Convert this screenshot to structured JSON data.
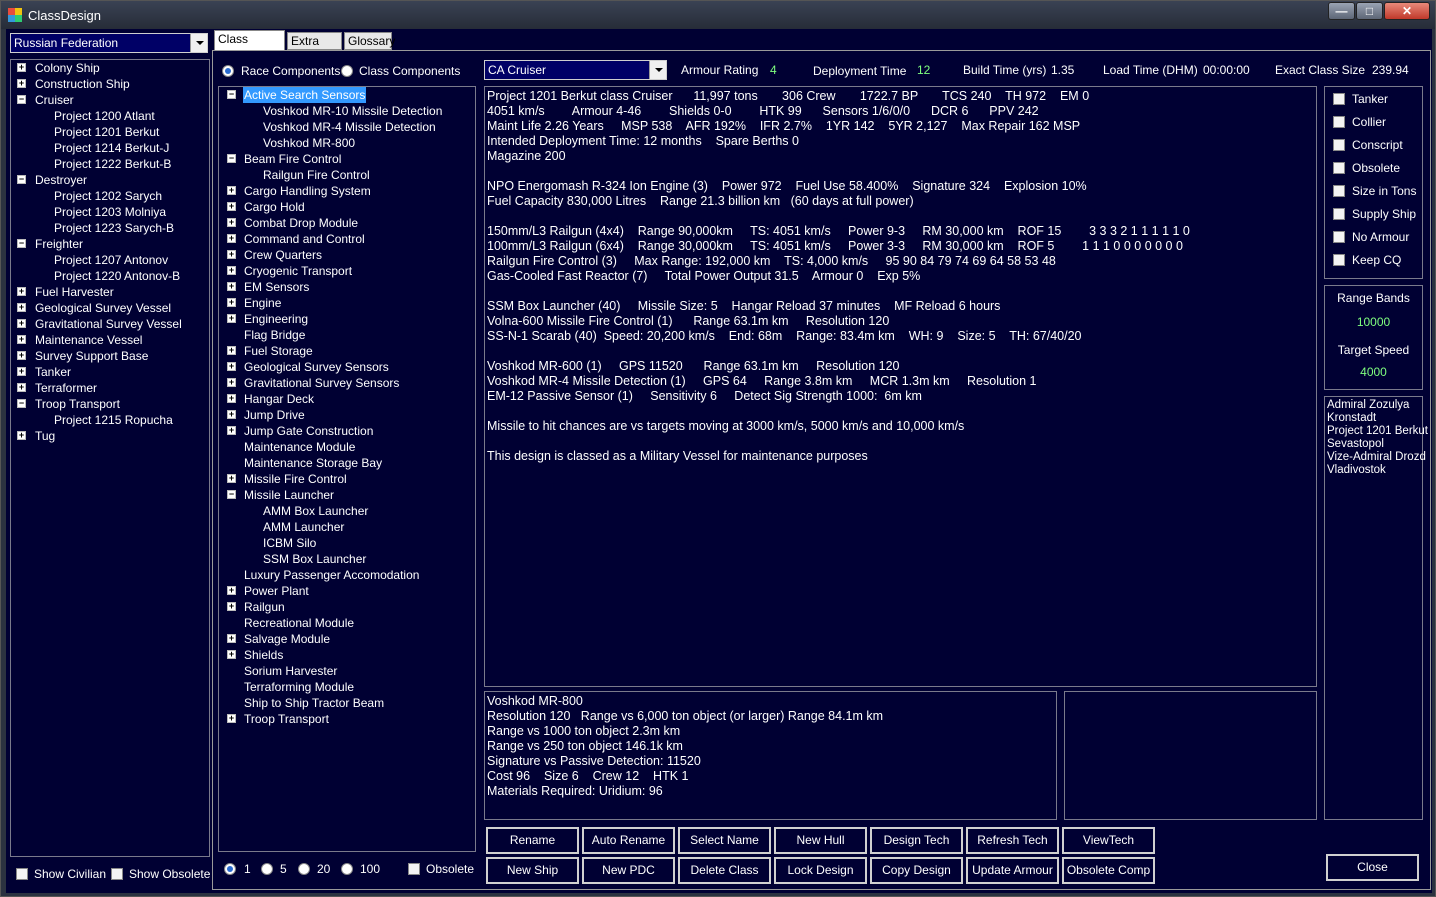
{
  "window": {
    "title": "ClassDesign",
    "minimize": "—",
    "maximize": "□",
    "close": "✕"
  },
  "race_select": "Russian Federation",
  "class_tree": [
    {
      "label": "Colony Ship",
      "level": 0,
      "expander": "+"
    },
    {
      "label": "Construction Ship",
      "level": 0,
      "expander": "+"
    },
    {
      "label": "Cruiser",
      "level": 0,
      "expander": "−"
    },
    {
      "label": "Project 1200 Atlant",
      "level": 1,
      "expander": ""
    },
    {
      "label": "Project 1201 Berkut",
      "level": 1,
      "expander": ""
    },
    {
      "label": "Project 1214 Berkut-J",
      "level": 1,
      "expander": ""
    },
    {
      "label": "Project 1222 Berkut-B",
      "level": 1,
      "expander": ""
    },
    {
      "label": "Destroyer",
      "level": 0,
      "expander": "−"
    },
    {
      "label": "Project 1202 Sarych",
      "level": 1,
      "expander": ""
    },
    {
      "label": "Project 1203 Molniya",
      "level": 1,
      "expander": ""
    },
    {
      "label": "Project 1223 Sarych-B",
      "level": 1,
      "expander": ""
    },
    {
      "label": "Freighter",
      "level": 0,
      "expander": "−"
    },
    {
      "label": "Project 1207 Antonov",
      "level": 1,
      "expander": ""
    },
    {
      "label": "Project 1220 Antonov-B",
      "level": 1,
      "expander": ""
    },
    {
      "label": "Fuel Harvester",
      "level": 0,
      "expander": "+"
    },
    {
      "label": "Geological Survey Vessel",
      "level": 0,
      "expander": "+"
    },
    {
      "label": "Gravitational Survey Vessel",
      "level": 0,
      "expander": "+"
    },
    {
      "label": "Maintenance Vessel",
      "level": 0,
      "expander": "+"
    },
    {
      "label": "Survey Support Base",
      "level": 0,
      "expander": "+"
    },
    {
      "label": "Tanker",
      "level": 0,
      "expander": "+"
    },
    {
      "label": "Terraformer",
      "level": 0,
      "expander": "+"
    },
    {
      "label": "Troop Transport",
      "level": 0,
      "expander": "−"
    },
    {
      "label": "Project 1215 Ropucha",
      "level": 1,
      "expander": ""
    },
    {
      "label": "Tug",
      "level": 0,
      "expander": "+"
    }
  ],
  "bottom_left": {
    "show_civilian": "Show Civilian",
    "show_obsolete": "Show Obsolete"
  },
  "tabs": [
    "Class Design",
    "Extra Info",
    "Glossary"
  ],
  "component_source": {
    "race": "Race Components",
    "class": "Class Components"
  },
  "component_tree": [
    {
      "label": "Active Search Sensors",
      "level": 0,
      "expander": "−",
      "selected": true
    },
    {
      "label": "Voshkod MR-10 Missile Detection",
      "level": 1,
      "expander": ""
    },
    {
      "label": "Voshkod MR-4 Missile Detection",
      "level": 1,
      "expander": ""
    },
    {
      "label": "Voshkod MR-800",
      "level": 1,
      "expander": ""
    },
    {
      "label": "Beam Fire Control",
      "level": 0,
      "expander": "−"
    },
    {
      "label": "Railgun Fire Control",
      "level": 1,
      "expander": ""
    },
    {
      "label": "Cargo Handling System",
      "level": 0,
      "expander": "+"
    },
    {
      "label": "Cargo Hold",
      "level": 0,
      "expander": "+"
    },
    {
      "label": "Combat Drop Module",
      "level": 0,
      "expander": "+"
    },
    {
      "label": "Command and Control",
      "level": 0,
      "expander": "+"
    },
    {
      "label": "Crew Quarters",
      "level": 0,
      "expander": "+"
    },
    {
      "label": "Cryogenic Transport",
      "level": 0,
      "expander": "+"
    },
    {
      "label": "EM Sensors",
      "level": 0,
      "expander": "+"
    },
    {
      "label": "Engine",
      "level": 0,
      "expander": "+"
    },
    {
      "label": "Engineering",
      "level": 0,
      "expander": "+"
    },
    {
      "label": "Flag Bridge",
      "level": 0,
      "expander": ""
    },
    {
      "label": "Fuel Storage",
      "level": 0,
      "expander": "+"
    },
    {
      "label": "Geological Survey Sensors",
      "level": 0,
      "expander": "+"
    },
    {
      "label": "Gravitational Survey Sensors",
      "level": 0,
      "expander": "+"
    },
    {
      "label": "Hangar Deck",
      "level": 0,
      "expander": "+"
    },
    {
      "label": "Jump Drive",
      "level": 0,
      "expander": "+"
    },
    {
      "label": "Jump Gate Construction",
      "level": 0,
      "expander": "+"
    },
    {
      "label": "Maintenance Module",
      "level": 0,
      "expander": ""
    },
    {
      "label": "Maintenance Storage Bay",
      "level": 0,
      "expander": ""
    },
    {
      "label": "Missile Fire Control",
      "level": 0,
      "expander": "+"
    },
    {
      "label": "Missile Launcher",
      "level": 0,
      "expander": "−"
    },
    {
      "label": "AMM Box Launcher",
      "level": 1,
      "expander": ""
    },
    {
      "label": "AMM Launcher",
      "level": 1,
      "expander": ""
    },
    {
      "label": "ICBM Silo",
      "level": 1,
      "expander": ""
    },
    {
      "label": "SSM Box Launcher",
      "level": 1,
      "expander": ""
    },
    {
      "label": "Luxury Passenger Accomodation",
      "level": 0,
      "expander": ""
    },
    {
      "label": "Power Plant",
      "level": 0,
      "expander": "+"
    },
    {
      "label": "Railgun",
      "level": 0,
      "expander": "+"
    },
    {
      "label": "Recreational Module",
      "level": 0,
      "expander": ""
    },
    {
      "label": "Salvage Module",
      "level": 0,
      "expander": "+"
    },
    {
      "label": "Shields",
      "level": 0,
      "expander": "+"
    },
    {
      "label": "Sorium Harvester",
      "level": 0,
      "expander": ""
    },
    {
      "label": "Terraforming Module",
      "level": 0,
      "expander": ""
    },
    {
      "label": "Ship to Ship Tractor Beam",
      "level": 0,
      "expander": ""
    },
    {
      "label": "Troop Transport",
      "level": 0,
      "expander": "+"
    }
  ],
  "quantity_options": [
    "1",
    "5",
    "20",
    "100"
  ],
  "obsolete_label": "Obsolete",
  "header": {
    "class_select": "CA Cruiser",
    "armour_rating_label": "Armour Rating",
    "armour_rating": "4",
    "deployment_time_label": "Deployment Time",
    "deployment_time": "12",
    "build_time_label": "Build Time (yrs)",
    "build_time": "1.35",
    "load_time_label": "Load Time (DHM)",
    "load_time": "00:00:00",
    "exact_size_label": "Exact Class Size",
    "exact_size": "239.94"
  },
  "class_summary": [
    "Project 1201 Berkut class Cruiser      11,997 tons       306 Crew       1722.7 BP       TCS 240    TH 972    EM 0",
    "4051 km/s        Armour 4-46        Shields 0-0        HTK 99      Sensors 1/6/0/0      DCR 6      PPV 242",
    "Maint Life 2.26 Years     MSP 538    AFR 192%    IFR 2.7%    1YR 142    5YR 2,127    Max Repair 162 MSP",
    "Intended Deployment Time: 12 months    Spare Berths 0",
    "Magazine 200",
    "",
    "NPO Energomash R-324 Ion Engine (3)    Power 972    Fuel Use 58.400%    Signature 324    Explosion 10%",
    "Fuel Capacity 830,000 Litres    Range 21.3 billion km   (60 days at full power)",
    "",
    "150mm/L3 Railgun (4x4)    Range 90,000km     TS: 4051 km/s     Power 9-3     RM 30,000 km    ROF 15        3 3 3 2 1 1 1 1 1 0",
    "100mm/L3 Railgun (6x4)    Range 30,000km     TS: 4051 km/s     Power 3-3     RM 30,000 km    ROF 5        1 1 1 0 0 0 0 0 0 0",
    "Railgun Fire Control (3)     Max Range: 192,000 km    TS: 4,000 km/s     95 90 84 79 74 69 64 58 53 48",
    "Gas-Cooled Fast Reactor (7)     Total Power Output 31.5    Armour 0    Exp 5%",
    "",
    "SSM Box Launcher (40)     Missile Size: 5    Hangar Reload 37 minutes    MF Reload 6 hours",
    "Volna-600 Missile Fire Control (1)      Range 63.1m km     Resolution 120",
    "SS-N-1 Scarab (40)  Speed: 20,200 km/s    End: 68m    Range: 83.4m km    WH: 9    Size: 5    TH: 67/40/20",
    "",
    "Voshkod MR-600 (1)     GPS 11520      Range 63.1m km     Resolution 120",
    "Voshkod MR-4 Missile Detection (1)     GPS 64     Range 3.8m km     MCR 1.3m km     Resolution 1",
    "EM-12 Passive Sensor (1)     Sensitivity 6     Detect Sig Strength 1000:  6m km",
    "",
    "Missile to hit chances are vs targets moving at 3000 km/s, 5000 km/s and 10,000 km/s",
    "",
    "This design is classed as a Military Vessel for maintenance purposes"
  ],
  "component_detail": [
    "Voshkod MR-800",
    "Resolution 120   Range vs 6,000 ton object (or larger) Range 84.1m km",
    "Range vs 1000 ton object 2.3m km",
    "Range vs 250 ton object 146.1k km",
    "Signature vs Passive Detection: 11520",
    "Cost 96    Size 6    Crew 12    HTK 1",
    "Materials Required: Uridium: 96"
  ],
  "flags": [
    "Tanker",
    "Collier",
    "Conscript",
    "Obsolete",
    "Size in Tons",
    "Supply Ship",
    "No Armour",
    "Keep CQ"
  ],
  "range_bands": {
    "label": "Range Bands",
    "value": "10000",
    "target_speed_label": "Target Speed",
    "target_speed": "4000"
  },
  "fleet_info": [
    "Admiral Zozulya",
    "Kronstadt",
    "Project 1201 Berkut",
    "Sevastopol",
    "Vize-Admiral Drozd",
    "Vladivostok"
  ],
  "buttons_row1": [
    "Rename",
    "Auto Rename",
    "Select Name",
    "New Hull",
    "Design Tech",
    "Refresh Tech",
    "ViewTech"
  ],
  "buttons_row2": [
    "New Ship",
    "New PDC",
    "Delete Class",
    "Lock Design",
    "Copy Design",
    "Update Armour",
    "Obsolete Comp"
  ],
  "close_button": "Close",
  "colors": {
    "background": "#000033",
    "value_green": "#7fff7f",
    "selection": "#3399ff"
  }
}
